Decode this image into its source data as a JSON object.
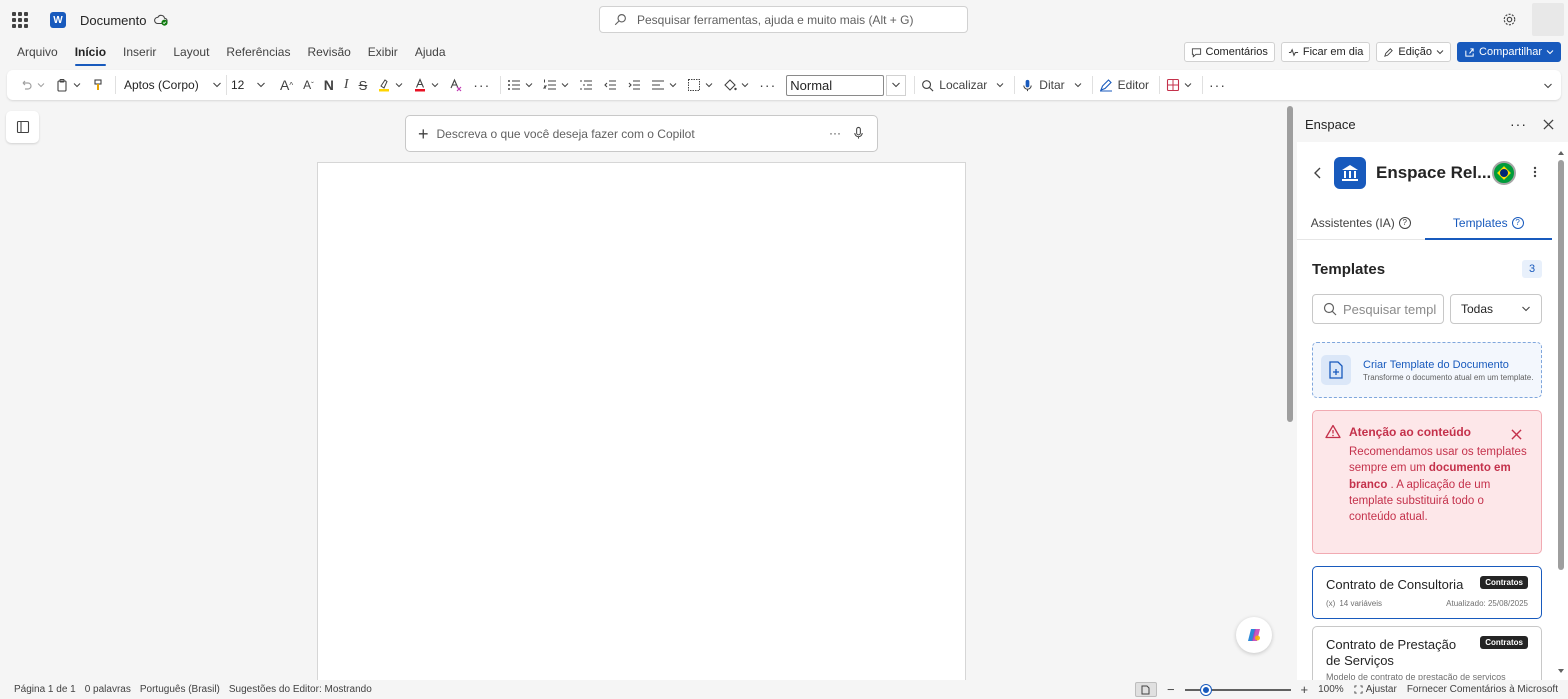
{
  "titlebar": {
    "doc_title": "Documento",
    "search_placeholder": "Pesquisar ferramentas, ajuda e muito mais (Alt + G)"
  },
  "menu": {
    "items": [
      "Arquivo",
      "Início",
      "Inserir",
      "Layout",
      "Referências",
      "Revisão",
      "Exibir",
      "Ajuda"
    ],
    "active": "Início",
    "comments_label": "Comentários",
    "catchup_label": "Ficar em dia",
    "editing_label": "Edição",
    "share_label": "Compartilhar"
  },
  "ribbon": {
    "font_name": "Aptos (Corpo)",
    "font_size": "12",
    "bold_glyph": "N",
    "italic_glyph": "I",
    "strike_glyph": "S",
    "style_name": "Normal",
    "find_label": "Localizar",
    "dictate_label": "Ditar",
    "editor_label": "Editor"
  },
  "copilot": {
    "placeholder": "Descreva o que você deseja fazer com o Copilot"
  },
  "panel": {
    "header": "Enspace",
    "app_name": "Enspace Rel...",
    "tabs": [
      {
        "label": "Assistentes (IA)",
        "active": false
      },
      {
        "label": "Templates",
        "active": true
      }
    ],
    "templates_title": "Templates",
    "templates_count": "3",
    "search_placeholder": "Pesquisar templ",
    "filter_value": "Todas",
    "create_card": {
      "title": "Criar Template do Documento",
      "subtitle": "Transforme o documento atual em um template..."
    },
    "warning": {
      "title": "Atenção ao conteúdo",
      "body_before": "Recomendamos usar os templates sempre em um ",
      "body_bold": "documento em branco",
      "body_after": " . A aplicação de um template substituirá todo o conteúdo atual."
    },
    "cards": [
      {
        "title": "Contrato de Consultoria",
        "badge": "Contratos",
        "vars": "14 variáveis",
        "updated": "Atualizado: 25/08/2025"
      },
      {
        "title": "Contrato de Prestação de Serviços",
        "badge": "Contratos",
        "desc": "Modelo de contrato de prestação de serviços"
      }
    ]
  },
  "status": {
    "page": "Página 1 de 1",
    "words": "0 palavras",
    "language": "Português (Brasil)",
    "editor": "Sugestões do Editor: Mostrando",
    "zoom": "100%",
    "fit": "Ajustar",
    "feedback": "Fornecer Comentários à Microsoft",
    "zoom_value": 0.2
  },
  "colors": {
    "accent": "#185abd",
    "warning": "#c4314b",
    "warning_bg": "#fde7e9"
  }
}
